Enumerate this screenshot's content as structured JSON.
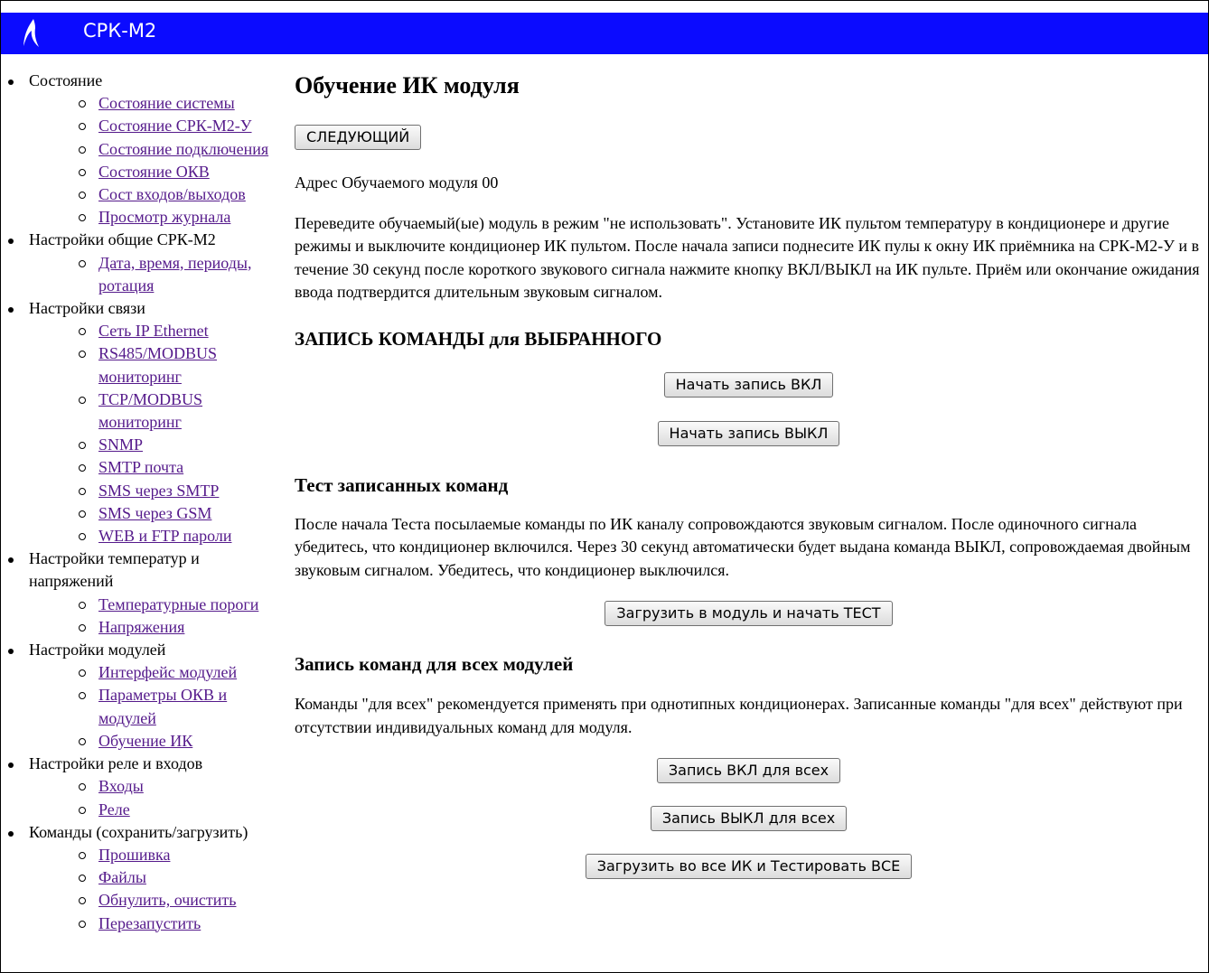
{
  "app": {
    "title": "СРК-М2"
  },
  "sidebar": {
    "sections": [
      {
        "label": "Состояние",
        "items": [
          "Состояние системы",
          "Состояние СРК-М2-У",
          "Состояние подключения",
          "Состояние ОКВ",
          "Сост входов/выходов",
          "Просмотр журнала"
        ]
      },
      {
        "label": "Настройки общие СРК-М2",
        "items": [
          "Дата, время, периоды, ротация"
        ]
      },
      {
        "label": "Настройки связи",
        "items": [
          "Сеть IP Ethernet",
          "RS485/MODBUS мониторинг",
          "TCP/MODBUS мониторинг",
          "SNMP",
          "SMTP почта",
          "SMS через SMTP",
          "SMS через GSM",
          "WEB и FTP пароли"
        ]
      },
      {
        "label": "Настройки температур и напряжений",
        "items": [
          "Температурные пороги",
          "Напряжения"
        ]
      },
      {
        "label": "Настройки модулей",
        "items": [
          "Интерфейс модулей",
          "Параметры ОКВ и модулей",
          "Обучение ИК"
        ]
      },
      {
        "label": "Настройки реле и входов",
        "items": [
          "Входы",
          "Реле"
        ]
      },
      {
        "label": "Команды (сохранить/загрузить)",
        "items": [
          "Прошивка",
          "Файлы",
          "Обнулить, очистить",
          "Перезапустить"
        ]
      }
    ]
  },
  "main": {
    "title": "Обучение ИК модуля",
    "next_button": "СЛЕДУЮЩИЙ",
    "address_line": "Адрес Обучаемого модуля 00",
    "instructions": "Переведите обучаемый(ые) модуль в режим \"не использовать\". Установите ИК пультом температуру в кондиционере и другие режимы и выключите кондиционер ИК пультом. После начала записи поднесите ИК пулы к окну ИК приёмника на СРК-М2-У и в течение 30 секунд после короткого звукового сигнала нажмите кнопку ВКЛ/ВЫКЛ на ИК пульте. Приём или окончание ожидания ввода подтвердится длительным звуковым сигналом.",
    "record_selected": {
      "heading": "ЗАПИСЬ КОМАНДЫ для ВЫБРАННОГО",
      "btn_on": "Начать запись ВКЛ",
      "btn_off": "Начать запись ВЫКЛ"
    },
    "test": {
      "heading": "Тест записанных команд",
      "text": "После начала Теста посылаемые команды по ИК каналу сопровождаются звуковым сигналом. После одиночного сигнала убедитесь, что кондиционер включился. Через 30 секунд автоматически будет выдана команда ВЫКЛ, сопровождаемая двойным звуковым сигналом. Убедитесь, что кондиционер выключился.",
      "btn": "Загрузить в модуль и начать ТЕСТ"
    },
    "record_all": {
      "heading": "Запись команд для всех модулей",
      "text": "Команды \"для всех\" рекомендуется применять при однотипных кондиционерах. Записанные команды \"для всех\" действуют при отсутствии индивидуальных команд для модуля.",
      "btn_on": "Запись ВКЛ для всех",
      "btn_off": "Запись ВЫКЛ для всех",
      "btn_test_all": "Загрузить во все ИК и Тестировать ВСЕ"
    }
  }
}
